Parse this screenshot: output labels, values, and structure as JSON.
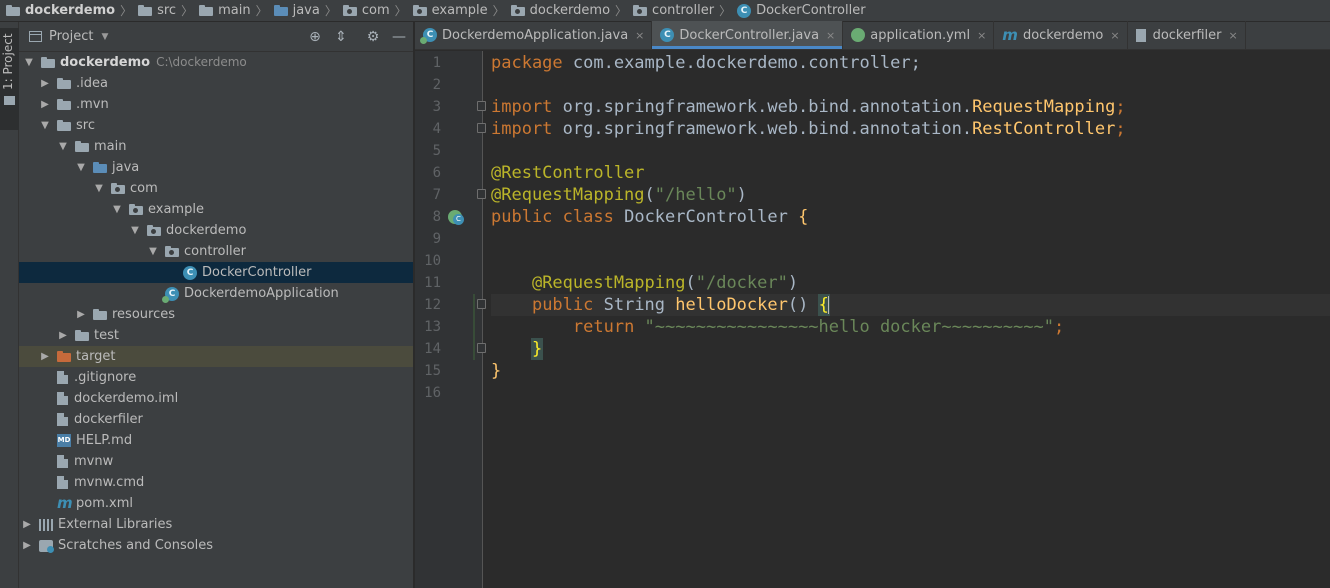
{
  "breadcrumb": [
    "dockerdemo",
    "src",
    "main",
    "java",
    "com",
    "example",
    "dockerdemo",
    "controller",
    "DockerController"
  ],
  "toolstrip": {
    "project_label": "1: Project"
  },
  "project_panel": {
    "title": "Project",
    "tree": [
      {
        "label": "dockerdemo",
        "path": "C:\\dockerdemo"
      },
      {
        "label": ".idea"
      },
      {
        "label": ".mvn"
      },
      {
        "label": "src"
      },
      {
        "label": "main"
      },
      {
        "label": "java"
      },
      {
        "label": "com"
      },
      {
        "label": "example"
      },
      {
        "label": "dockerdemo"
      },
      {
        "label": "controller"
      },
      {
        "label": "DockerController"
      },
      {
        "label": "DockerdemoApplication"
      },
      {
        "label": "resources"
      },
      {
        "label": "test"
      },
      {
        "label": "target"
      },
      {
        "label": ".gitignore"
      },
      {
        "label": "dockerdemo.iml"
      },
      {
        "label": "dockerfiler"
      },
      {
        "label": "HELP.md"
      },
      {
        "label": "mvnw"
      },
      {
        "label": "mvnw.cmd"
      },
      {
        "label": "pom.xml"
      },
      {
        "label": "External Libraries"
      },
      {
        "label": "Scratches and Consoles"
      }
    ]
  },
  "tabs": [
    {
      "label": "DockerdemoApplication.java"
    },
    {
      "label": "DockerController.java"
    },
    {
      "label": "application.yml"
    },
    {
      "label": "dockerdemo"
    },
    {
      "label": "dockerfiler"
    }
  ],
  "tab_close": "×",
  "icons": {
    "class": "C",
    "project_header": "project-icon",
    "settings": "gear-icon",
    "hide": "minus-icon",
    "locate": "target-icon",
    "collapse": "collapse-icon"
  },
  "line_numbers": [
    "1",
    "2",
    "3",
    "4",
    "5",
    "6",
    "7",
    "8",
    "9",
    "10",
    "11",
    "12",
    "13",
    "14",
    "15",
    "16"
  ],
  "code": {
    "l1": {
      "kw": "package",
      "rest": " com.example.dockerdemo.controller;"
    },
    "l3": {
      "kw": "import",
      "pkg": " org.springframework.web.bind.annotation.",
      "cls": "RequestMapping",
      "semi": ";"
    },
    "l4": {
      "kw": "import",
      "pkg": " org.springframework.web.bind.annotation.",
      "cls": "RestController",
      "semi": ";"
    },
    "l6": {
      "ann": "@RestController"
    },
    "l7": {
      "ann": "@RequestMapping",
      "open": "(",
      "str": "\"/hello\"",
      "close": ")"
    },
    "l8": {
      "kw1": "public",
      "kw2": "class",
      "name": " DockerController ",
      "brace": "{"
    },
    "l11": {
      "ann": "@RequestMapping",
      "open": "(",
      "str": "\"/docker\"",
      "close": ")"
    },
    "l12": {
      "kw": "public",
      "type": " String ",
      "fn": "helloDocker",
      "parens": "() ",
      "brace": "{"
    },
    "l13": {
      "kw": "return",
      "str": " \"~~~~~~~~~~~~~~~~hello docker~~~~~~~~~~\"",
      "semi": ";"
    },
    "l14": {
      "brace": "}"
    },
    "l15": {
      "brace": "}"
    }
  },
  "colors": {
    "keyword": "#cc7832",
    "annotation": "#bbb529",
    "string": "#6a8759",
    "function": "#ffc66d",
    "selection": "#0d293e",
    "tab_underline": "#4a88c7"
  }
}
